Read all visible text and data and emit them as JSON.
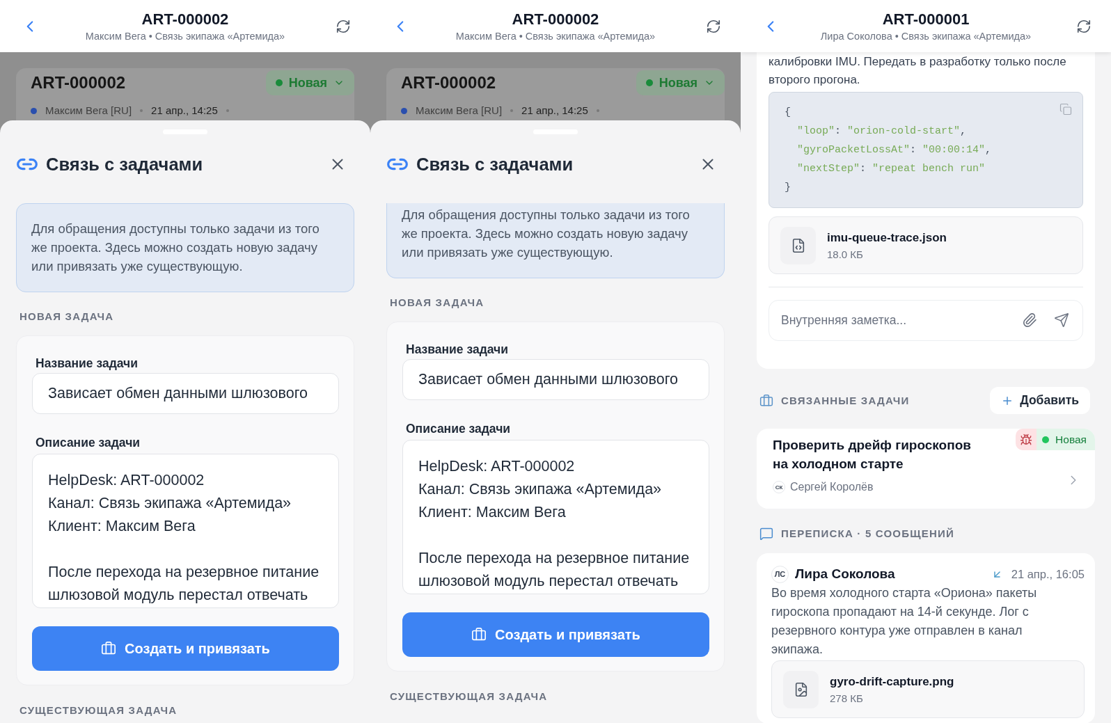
{
  "screens": [
    {
      "kind": "link_sheet",
      "header": {
        "title": "ART-000002",
        "subtitle": "Максим Вега • Связь экипажа «Артемида»"
      },
      "backdrop": {
        "ticket": "ART-000002",
        "status": "Новая",
        "author": "Максим Вега [RU]",
        "time": "21 апр., 14:25"
      },
      "sheet": {
        "title": "Связь с задачами",
        "scrolled": false,
        "notice": "Для обращения доступны только задачи из того же проекта. Здесь можно создать новую задачу или привязать уже существующую.",
        "new_task": {
          "heading": "НОВАЯ ЗАДАЧА",
          "name_label": "Название задачи",
          "name_value": "Зависает обмен данными шлюзового",
          "description_label": "Описание задачи",
          "description_value": "HelpDesk: ART-000002\nКанал: Связь экипажа «Артемида»\nКлиент: Максим Вега\n\nПосле перехода на резервное питание шлюзовой модуль перестал отвечать",
          "submit": "Создать и привязать"
        },
        "existing_task": {
          "heading": "СУЩЕСТВУЮЩАЯ ЗАДАЧА"
        }
      }
    },
    {
      "kind": "link_sheet",
      "header": {
        "title": "ART-000002",
        "subtitle": "Максим Вега • Связь экипажа «Артемида»"
      },
      "backdrop": {
        "ticket": "ART-000002",
        "status": "Новая",
        "author": "Максим Вега [RU]",
        "time": "21 апр., 14:25"
      },
      "sheet": {
        "title": "Связь с задачами",
        "scrolled": true,
        "notice": "Для обращения доступны только задачи из того же проекта. Здесь можно создать новую задачу или привязать уже существующую.",
        "new_task": {
          "heading": "НОВАЯ ЗАДАЧА",
          "name_label": "Название задачи",
          "name_value": "Зависает обмен данными шлюзового",
          "description_label": "Описание задачи",
          "description_value": "HelpDesk: ART-000002\nКанал: Связь экипажа «Артемида»\nКлиент: Максим Вега\n\nПосле перехода на резервное питание шлюзовой модуль перестал отвечать",
          "submit": "Создать и привязать"
        },
        "existing_task": {
          "heading": "СУЩЕСТВУЮЩАЯ ЗАДАЧА"
        }
      }
    },
    {
      "kind": "ticket_detail",
      "header": {
        "title": "ART-000001",
        "subtitle": "Лира Соколова • Связь экипажа «Артемида»"
      },
      "note_card": {
        "text": "калибровки IMU. Передать в разработку только после второго прогона.",
        "code": [
          "{",
          "  \"loop\": \"orion-cold-start\",",
          "  \"gyroPacketLossAt\": \"00:00:14\",",
          "  \"nextStep\": \"repeat bench run\"",
          "}"
        ],
        "file": {
          "kind": "code",
          "name": "imu-queue-trace.json",
          "size": "18.0 КБ"
        },
        "note_placeholder": "Внутренняя заметка..."
      },
      "linked_tasks": {
        "heading": "СВЯЗАННЫЕ ЗАДАЧИ",
        "add": "Добавить",
        "items": [
          {
            "kind": "bug",
            "title": "Проверить дрейф гироскопов на холодном старте",
            "status": "Новая",
            "assignee_initials": "СК",
            "assignee": "Сергей Королёв"
          }
        ]
      },
      "conversation": {
        "heading": "ПЕРЕПИСКА · 5 СООБЩЕНИЙ",
        "messages": [
          {
            "kind": "incoming",
            "initials": "ЛС",
            "author": "Лира Соколова",
            "time": "21 апр., 16:05",
            "text": "Во время холодного старта «Ориона» пакеты гироскопа пропадают на 14-й секунде. Лог с резервного контура уже отправлен в канал экипажа.",
            "attachments": [
              {
                "kind": "image",
                "name": "gyro-drift-capture.png",
                "size": "278 КБ"
              }
            ]
          }
        ]
      }
    }
  ]
}
